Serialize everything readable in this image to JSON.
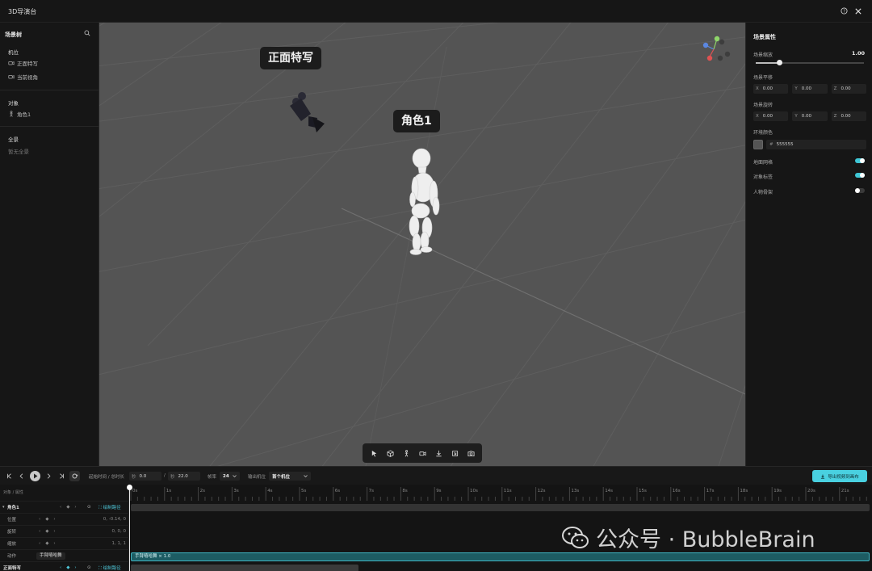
{
  "window": {
    "title": "3D导演台"
  },
  "left_panel": {
    "title": "场景树",
    "cameras_title": "机位",
    "cameras": [
      "正面特写",
      "当前视角"
    ],
    "objects_title": "对象",
    "objects": [
      "角色1"
    ],
    "scenes_title": "全景",
    "scenes_empty": "暂无全景"
  },
  "viewport": {
    "labels": [
      "正面特写",
      "角色1"
    ],
    "toolbar": [
      "select-icon",
      "cube-icon",
      "person-icon",
      "camera-icon",
      "download-icon",
      "frame-icon",
      "snapshot-icon"
    ]
  },
  "right_panel": {
    "title": "场景属性",
    "scale_label": "场景缩放",
    "scale_value": "1.00",
    "scale_fraction": 0.22,
    "translate_label": "场景平移",
    "translate": {
      "x": "0.00",
      "y": "0.00",
      "z": "0.00"
    },
    "rotate_label": "场景旋转",
    "rotate": {
      "x": "0.00",
      "y": "0.00",
      "z": "0.00"
    },
    "env_color_label": "环境颜色",
    "env_color_hex": "555555",
    "env_color": "#555555",
    "toggles": [
      {
        "label": "地面网格",
        "on": true
      },
      {
        "label": "对象标签",
        "on": true
      },
      {
        "label": "人物骨架",
        "on": false
      }
    ]
  },
  "transport": {
    "time_label": "起始时间 / 总时长",
    "start_unit": "秒",
    "start_value": "0.0",
    "separator": "/",
    "total_unit": "秒",
    "total_value": "22.0",
    "fps_label": "帧率",
    "fps_value": "24",
    "output_label": "输出机位",
    "output_value": "首个机位",
    "export_label": "导出视频到画布"
  },
  "timeline": {
    "header": "对象 / 属性",
    "ticks": [
      "0s",
      "1s",
      "2s",
      "3s",
      "4s",
      "5s",
      "6s",
      "7s",
      "8s",
      "9s",
      "10s",
      "11s",
      "12s",
      "13s",
      "14s",
      "15s",
      "16s",
      "17s",
      "18s",
      "19s",
      "20s",
      "21s"
    ],
    "rows": [
      {
        "name": "角色1",
        "draw_label": "绘制路径"
      },
      {
        "name": "位置",
        "value": "0, -0.14, 0"
      },
      {
        "name": "旋转",
        "value": "0, 0, 0"
      },
      {
        "name": "缩放",
        "value": "1, 1, 1"
      },
      {
        "name": "动作",
        "select": "手臂嘻哈舞"
      },
      {
        "name": "正面特写",
        "draw_label": "绘制路径"
      }
    ],
    "clip_label": "手臂嘻哈舞 × 1.0"
  },
  "watermark": {
    "text": "公众号 · BubbleBrain"
  },
  "colors": {
    "accent": "#49d0e0",
    "viewport_bg": "#545454",
    "panel_bg": "#161616"
  }
}
